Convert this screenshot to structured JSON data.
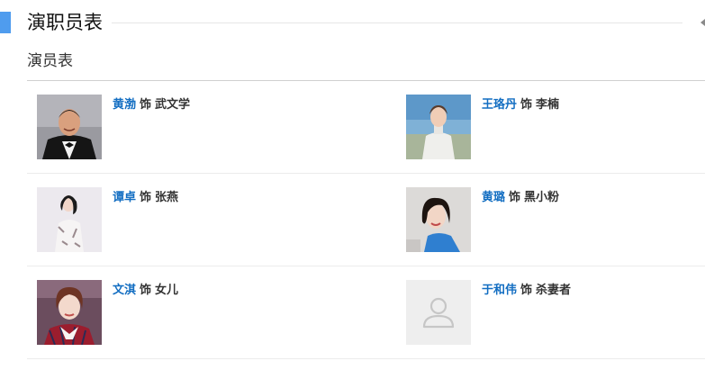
{
  "section": {
    "title": "演职员表"
  },
  "subsection": {
    "title": "演员表"
  },
  "cast": [
    {
      "actor": "黄渤",
      "plays": "饰",
      "role": "武文学",
      "photo": "photo-huang-bo"
    },
    {
      "actor": "王珞丹",
      "plays": "饰",
      "role": "李楠",
      "photo": "photo-wang-luodan"
    },
    {
      "actor": "谭卓",
      "plays": "饰",
      "role": "张燕",
      "photo": "photo-tan-zhuo"
    },
    {
      "actor": "黄璐",
      "plays": "饰",
      "role": "黑小粉",
      "photo": "photo-huang-lu"
    },
    {
      "actor": "文淇",
      "plays": "饰",
      "role": "女儿",
      "photo": "photo-wen-qi"
    },
    {
      "actor": "于和伟",
      "plays": "饰",
      "role": "杀妻者",
      "photo": "default-user-icon"
    }
  ],
  "colors": {
    "accent_bar": "#4f9cee",
    "actor_link": "#136ec2",
    "text": "#333333",
    "placeholder_bg": "#eeeeee",
    "placeholder_icon": "#c6c6c6"
  }
}
